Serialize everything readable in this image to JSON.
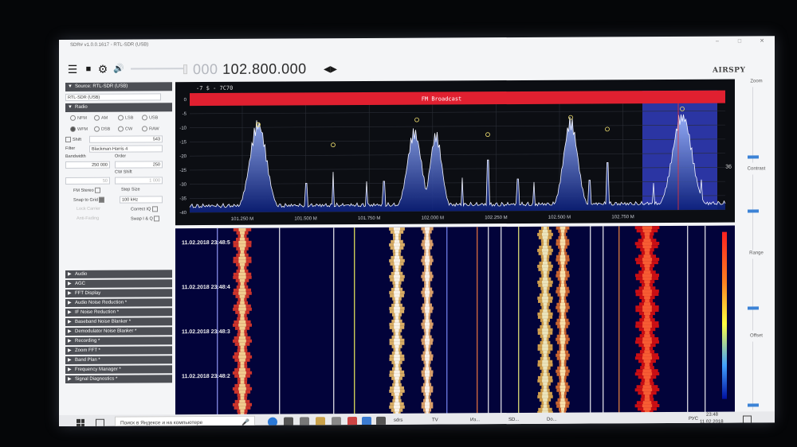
{
  "window": {
    "title": "SDR# v1.0.0.1617 - RTL-SDR (USB)",
    "minimize": "–",
    "maximize": "□",
    "close": "✕"
  },
  "toolbar": {
    "frequency_dim": "000",
    "frequency": "102.800.000",
    "arrows": "◀▶",
    "logo": "AIRSPY",
    "menu_icon": "☰",
    "stop_icon": "■",
    "gear_icon": "⚙",
    "speaker_icon": "🔊"
  },
  "source": {
    "header": "Source: RTL-SDR (USB)",
    "device": "RTL-SDR (USB)"
  },
  "radio": {
    "header": "Radio",
    "modes_row1": [
      "NFM",
      "AM",
      "LSB",
      "USB"
    ],
    "modes_row2": [
      "WFM",
      "DSB",
      "CW",
      "RAW"
    ],
    "selected_mode": "WFM",
    "shift_label": "Shift",
    "shift_value": "543",
    "filter_label": "Filter",
    "filter_value": "Blackman-Harris 4",
    "bandwidth_label": "Bandwidth",
    "bandwidth_value": "250 000",
    "order_label": "Order",
    "order_value": "250",
    "squelch_value": "50",
    "cw_shift_label": "CW Shift",
    "cw_shift_value": "1 000",
    "fm_stereo_label": "FM Stereo",
    "step_size_label": "Step Size",
    "snap_label": "Snap to Grid",
    "step_value": "100 kHz",
    "correct_iq_label": "Correct IQ",
    "swap_iq_label": "Swap I & Q",
    "lock_carrier_label": "Lock Carrier",
    "anti_fading_label": "Anti-Fading"
  },
  "collapsed_sections": [
    "Audio",
    "AGC",
    "FFT Display",
    "Audio Noise Reduction *",
    "IF Noise Reduction *",
    "Baseband Noise Blanker *",
    "Demodulator Noise Blanker *",
    "Recording *",
    "Zoom FFT *",
    "Band Plan *",
    "Frequency Manager *",
    "Signal Diagnostics *"
  ],
  "spectrum": {
    "readout": "-7 $  - 7C70",
    "band_label": "FM Broadcast",
    "y_ticks": [
      "0",
      "-5",
      "-10",
      "-15",
      "-20",
      "-25",
      "-30",
      "-35",
      "-40"
    ],
    "x_ticks": [
      "101.250 M",
      "101.500 M",
      "101.750 M",
      "102.000 M",
      "102.250 M",
      "102.500 M",
      "102.750 M"
    ],
    "side_value": "36"
  },
  "waterfall": {
    "timestamps": [
      "11.02.2018 23:48:5",
      "11.02.2018 23:48:4",
      "11.02.2018 23:48:3",
      "11.02.2018 23:48:2"
    ]
  },
  "right_controls": {
    "zoom": "Zoom",
    "contrast": "Contrast",
    "range": "Range",
    "offset": "Offset"
  },
  "taskbar": {
    "search_placeholder": "Поиск в Яндексе и на компьютере",
    "apps": [
      "sdrs",
      "TV",
      "Из...",
      "SD...",
      "Do..."
    ],
    "lang": "РУС",
    "time": "23:48",
    "date": "11.02.2018"
  },
  "colors": {
    "band_bar": "#e02030",
    "spectrum_fill": "#2f63d8",
    "selection": "#3340c8",
    "accent": "#3c83d6"
  }
}
